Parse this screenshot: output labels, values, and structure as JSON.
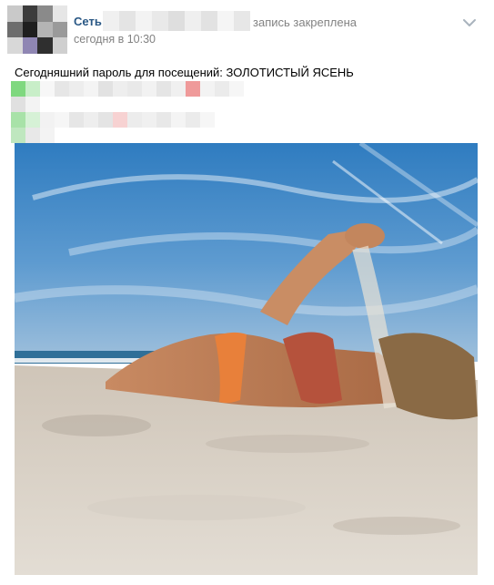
{
  "post": {
    "author": "Сеть",
    "pinned_note": "запись закреплена",
    "time": "сегодня в 10:30",
    "text": "Сегодняшний пароль для посещений: ЗОЛОТИСТЫЙ ЯСЕНЬ"
  },
  "colors": {
    "link": "#2a5885",
    "meta": "#828282",
    "sky": "#3f86c2",
    "sand": "#d9d2c8",
    "swimsuit": "#e8803a"
  },
  "icons": {
    "menu": "chevron-down-icon"
  }
}
